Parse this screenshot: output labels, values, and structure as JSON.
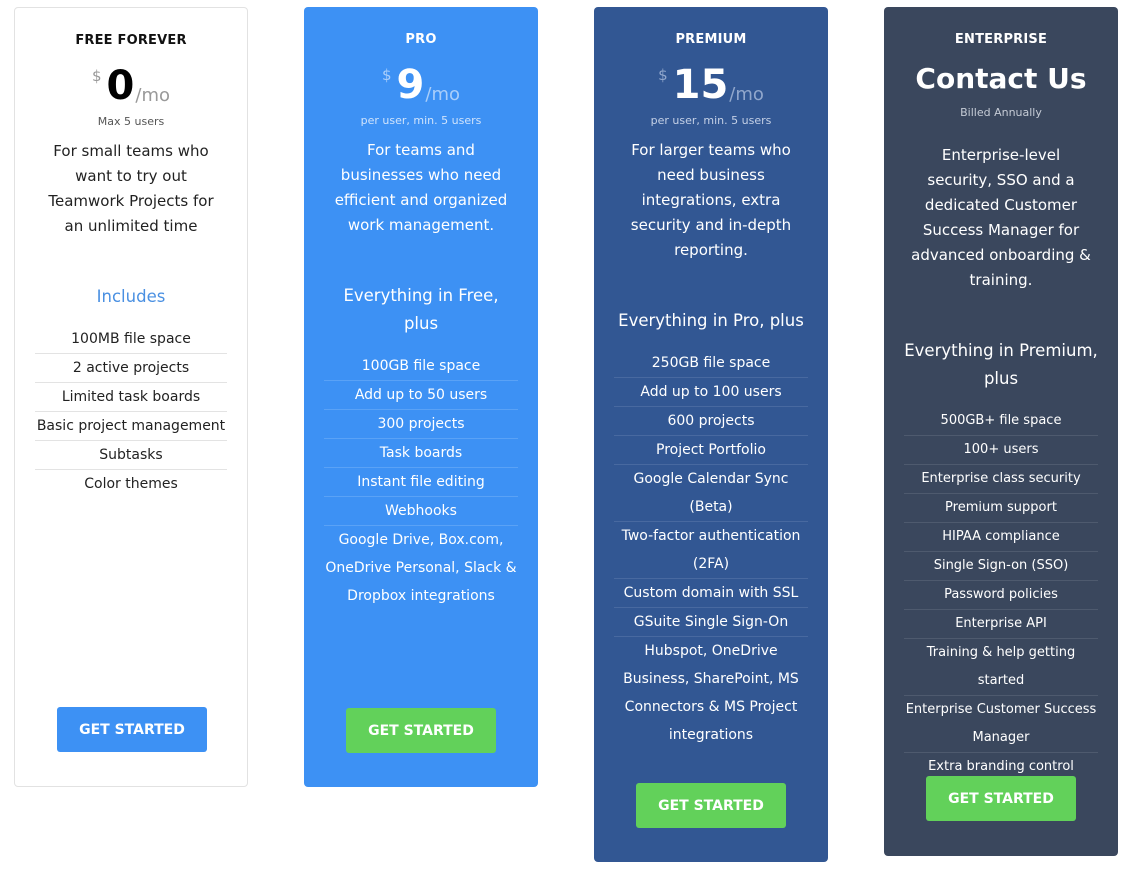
{
  "plans": [
    {
      "name": "FREE FOREVER",
      "currency": "$",
      "amount": "0",
      "period": "/mo",
      "subtitle": "Max 5 users",
      "description": "For small teams who want to try out Teamwork Projects for an unlimited time",
      "section_title": "Includes",
      "features": [
        "100MB file space",
        "2 active projects",
        "Limited task boards",
        "Basic project management",
        "Subtasks",
        "Color themes"
      ],
      "cta": "GET STARTED"
    },
    {
      "name": "PRO",
      "currency": "$",
      "amount": "9",
      "period": "/mo",
      "subtitle": "per user, min. 5 users",
      "description": "For teams and businesses who need efficient and organized work management.",
      "section_title": "Everything in Free, plus",
      "features": [
        "100GB file space",
        "Add up to 50 users",
        "300 projects",
        "Task boards",
        "Instant file editing",
        "Webhooks",
        "Google Drive, Box.com, OneDrive Personal, Slack & Dropbox integrations"
      ],
      "cta": "GET STARTED"
    },
    {
      "name": "PREMIUM",
      "currency": "$",
      "amount": "15",
      "period": "/mo",
      "subtitle": "per user, min. 5 users",
      "description": "For larger teams who need business integrations, extra security and in-depth reporting.",
      "section_title": "Everything in Pro, plus",
      "features": [
        "250GB file space",
        "Add up to 100 users",
        "600 projects",
        "Project Portfolio",
        "Google Calendar Sync (Beta)",
        "Two-factor authentication (2FA)",
        "Custom domain with SSL",
        "GSuite Single Sign-On",
        "Hubspot, OneDrive Business, SharePoint, MS Connectors & MS Project integrations"
      ],
      "cta": "GET STARTED"
    },
    {
      "name": "ENTERPRISE",
      "contact": "Contact Us",
      "subtitle": "Billed Annually",
      "description": "Enterprise-level security, SSO and a dedicated Customer Success Manager for advanced onboarding & training.",
      "section_title": "Everything in Premium, plus",
      "features": [
        "500GB+ file space",
        "100+ users",
        "Enterprise class security",
        "Premium support",
        "HIPAA compliance",
        "Single Sign-on (SSO)",
        "Password policies",
        "Enterprise API",
        "Training & help getting started",
        "Enterprise Customer Success Manager",
        "Extra branding control"
      ],
      "cta": "GET STARTED"
    }
  ],
  "colors": {
    "free_bg": "#ffffff",
    "pro_bg": "#3d91f4",
    "premium_bg": "#325793",
    "enterprise_bg": "#3a475d",
    "accent_blue": "#3d91f4",
    "cta_green": "#62d15a",
    "includes_blue": "#4a90e2"
  }
}
